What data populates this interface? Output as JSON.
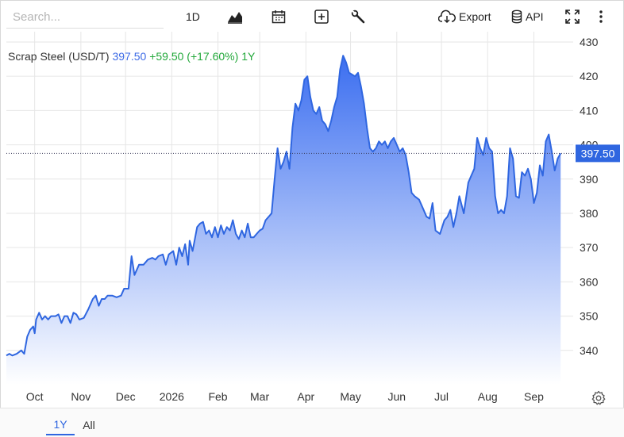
{
  "toolbar": {
    "search_placeholder": "Search...",
    "interval_label": "1D",
    "chart_type_icon": "area-chart-icon",
    "calendar_icon": "calendar-icon",
    "add_icon": "plus-box-icon",
    "tools_icon": "wrench-icon",
    "export_label": "Export",
    "export_icon": "cloud-download-icon",
    "api_label": "API",
    "api_icon": "database-icon",
    "fullscreen_icon": "fullscreen-icon",
    "menu_icon": "kebab-menu-icon"
  },
  "legend": {
    "name": "Scrap Steel (USD/T)",
    "price": "397.50",
    "change": "+59.50 (+17.60%)",
    "period": "1Y"
  },
  "price_tag": "397.50",
  "ranges": [
    {
      "label": "1Y",
      "active": true
    },
    {
      "label": "All",
      "active": false
    }
  ],
  "settings_icon": "gear-icon",
  "colors": {
    "line": "#2f66e0",
    "fill_top": "#3b6ef0",
    "fill_bottom": "#ffffff",
    "price_tag_bg": "#2f66e0",
    "positive": "#22a83a",
    "grid": "#e6e6e6"
  },
  "chart_data": {
    "type": "area",
    "title": "Scrap Steel (USD/T)",
    "xlabel": "",
    "ylabel": "",
    "ylim": [
      330,
      433
    ],
    "y_ticks": [
      340,
      350,
      360,
      370,
      380,
      390,
      400,
      410,
      420,
      430
    ],
    "x_ticks": [
      "Oct",
      "Nov",
      "Dec",
      "2026",
      "Feb",
      "Mar",
      "Apr",
      "May",
      "Jun",
      "Jul",
      "Aug",
      "Sep"
    ],
    "x_range": [
      "2025-09-12",
      "2026-09-21"
    ],
    "current_value": 397.5,
    "grid": true,
    "series": [
      {
        "name": "Scrap Steel (USD/T)",
        "points": [
          [
            "2025-09-12",
            338.5
          ],
          [
            "2025-09-14",
            339
          ],
          [
            "2025-09-16",
            338.5
          ],
          [
            "2025-09-19",
            339
          ],
          [
            "2025-09-22",
            340
          ],
          [
            "2025-09-24",
            339
          ],
          [
            "2025-09-26",
            344
          ],
          [
            "2025-09-28",
            346
          ],
          [
            "2025-09-30",
            347
          ],
          [
            "2025-10-01",
            345
          ],
          [
            "2025-10-02",
            349
          ],
          [
            "2025-10-04",
            351
          ],
          [
            "2025-10-06",
            349
          ],
          [
            "2025-10-08",
            350
          ],
          [
            "2025-10-10",
            349
          ],
          [
            "2025-10-12",
            350
          ],
          [
            "2025-10-15",
            350
          ],
          [
            "2025-10-17",
            350.5
          ],
          [
            "2025-10-19",
            348
          ],
          [
            "2025-10-21",
            350
          ],
          [
            "2025-10-23",
            350
          ],
          [
            "2025-10-25",
            348
          ],
          [
            "2025-10-27",
            351
          ],
          [
            "2025-10-29",
            350.5
          ],
          [
            "2025-10-31",
            349
          ],
          [
            "2025-11-03",
            349.5
          ],
          [
            "2025-11-06",
            352
          ],
          [
            "2025-11-09",
            355
          ],
          [
            "2025-11-11",
            356
          ],
          [
            "2025-11-13",
            353
          ],
          [
            "2025-11-15",
            355
          ],
          [
            "2025-11-17",
            355
          ],
          [
            "2025-11-19",
            356
          ],
          [
            "2025-11-22",
            356
          ],
          [
            "2025-11-25",
            355.5
          ],
          [
            "2025-11-28",
            356
          ],
          [
            "2025-11-30",
            358
          ],
          [
            "2025-12-03",
            358
          ],
          [
            "2025-12-05",
            367.5
          ],
          [
            "2025-12-07",
            362
          ],
          [
            "2025-12-10",
            365
          ],
          [
            "2025-12-13",
            365
          ],
          [
            "2025-12-16",
            366.5
          ],
          [
            "2025-12-19",
            367
          ],
          [
            "2025-12-21",
            366.5
          ],
          [
            "2025-12-23",
            367.5
          ],
          [
            "2025-12-26",
            368
          ],
          [
            "2025-12-28",
            365
          ],
          [
            "2025-12-30",
            368
          ],
          [
            "2026-01-02",
            369
          ],
          [
            "2026-01-04",
            365
          ],
          [
            "2026-01-06",
            370
          ],
          [
            "2026-01-08",
            367.5
          ],
          [
            "2026-01-10",
            371
          ],
          [
            "2026-01-12",
            365
          ],
          [
            "2026-01-13",
            372
          ],
          [
            "2026-01-15",
            369
          ],
          [
            "2026-01-18",
            376
          ],
          [
            "2026-01-20",
            377
          ],
          [
            "2026-01-22",
            377.5
          ],
          [
            "2026-01-24",
            374
          ],
          [
            "2026-01-26",
            375
          ],
          [
            "2026-01-28",
            373
          ],
          [
            "2026-01-30",
            376
          ],
          [
            "2026-02-01",
            373
          ],
          [
            "2026-02-03",
            376.5
          ],
          [
            "2026-02-05",
            374
          ],
          [
            "2026-02-07",
            376
          ],
          [
            "2026-02-09",
            375
          ],
          [
            "2026-02-11",
            378
          ],
          [
            "2026-02-13",
            374
          ],
          [
            "2026-02-15",
            372.5
          ],
          [
            "2026-02-17",
            375
          ],
          [
            "2026-02-19",
            373
          ],
          [
            "2026-02-21",
            377
          ],
          [
            "2026-02-23",
            373
          ],
          [
            "2026-02-25",
            373
          ],
          [
            "2026-02-27",
            374
          ],
          [
            "2026-03-01",
            375
          ],
          [
            "2026-03-03",
            375.5
          ],
          [
            "2026-03-05",
            378
          ],
          [
            "2026-03-07",
            379
          ],
          [
            "2026-03-09",
            380
          ],
          [
            "2026-03-11",
            390
          ],
          [
            "2026-03-13",
            399
          ],
          [
            "2026-03-15",
            393
          ],
          [
            "2026-03-17",
            395
          ],
          [
            "2026-03-19",
            398
          ],
          [
            "2026-03-21",
            393
          ],
          [
            "2026-03-23",
            405
          ],
          [
            "2026-03-25",
            412
          ],
          [
            "2026-03-27",
            410
          ],
          [
            "2026-03-29",
            413
          ],
          [
            "2026-03-31",
            419
          ],
          [
            "2026-04-02",
            420
          ],
          [
            "2026-04-04",
            414
          ],
          [
            "2026-04-06",
            410
          ],
          [
            "2026-04-08",
            409
          ],
          [
            "2026-04-10",
            411
          ],
          [
            "2026-04-12",
            407
          ],
          [
            "2026-04-14",
            406
          ],
          [
            "2026-04-16",
            404
          ],
          [
            "2026-04-18",
            407
          ],
          [
            "2026-04-20",
            411
          ],
          [
            "2026-04-22",
            414
          ],
          [
            "2026-04-24",
            422
          ],
          [
            "2026-04-26",
            426
          ],
          [
            "2026-04-28",
            424
          ],
          [
            "2026-04-30",
            421
          ],
          [
            "2026-05-02",
            420.5
          ],
          [
            "2026-05-04",
            420
          ],
          [
            "2026-05-06",
            421
          ],
          [
            "2026-05-08",
            417
          ],
          [
            "2026-05-10",
            412
          ],
          [
            "2026-05-12",
            405
          ],
          [
            "2026-05-14",
            399
          ],
          [
            "2026-05-16",
            398
          ],
          [
            "2026-05-18",
            399
          ],
          [
            "2026-05-20",
            401
          ],
          [
            "2026-05-22",
            400
          ],
          [
            "2026-05-24",
            401
          ],
          [
            "2026-05-26",
            399
          ],
          [
            "2026-05-28",
            401
          ],
          [
            "2026-05-30",
            402
          ],
          [
            "2026-06-01",
            400
          ],
          [
            "2026-06-03",
            398
          ],
          [
            "2026-06-05",
            399
          ],
          [
            "2026-06-07",
            397
          ],
          [
            "2026-06-09",
            392
          ],
          [
            "2026-06-11",
            386
          ],
          [
            "2026-06-13",
            385
          ],
          [
            "2026-06-16",
            384
          ],
          [
            "2026-06-19",
            381
          ],
          [
            "2026-06-21",
            379
          ],
          [
            "2026-06-23",
            378.5
          ],
          [
            "2026-06-25",
            383
          ],
          [
            "2026-06-27",
            375
          ],
          [
            "2026-06-30",
            374
          ],
          [
            "2026-07-03",
            378
          ],
          [
            "2026-07-05",
            379
          ],
          [
            "2026-07-07",
            381
          ],
          [
            "2026-07-09",
            376
          ],
          [
            "2026-07-11",
            380
          ],
          [
            "2026-07-13",
            385
          ],
          [
            "2026-07-16",
            380
          ],
          [
            "2026-07-19",
            389
          ],
          [
            "2026-07-21",
            391
          ],
          [
            "2026-07-23",
            393
          ],
          [
            "2026-07-25",
            402
          ],
          [
            "2026-07-27",
            399
          ],
          [
            "2026-07-29",
            397
          ],
          [
            "2026-07-31",
            402
          ],
          [
            "2026-08-02",
            399
          ],
          [
            "2026-08-04",
            398
          ],
          [
            "2026-08-06",
            385
          ],
          [
            "2026-08-08",
            380
          ],
          [
            "2026-08-10",
            381
          ],
          [
            "2026-08-12",
            380
          ],
          [
            "2026-08-14",
            385
          ],
          [
            "2026-08-16",
            399
          ],
          [
            "2026-08-18",
            396
          ],
          [
            "2026-08-20",
            385
          ],
          [
            "2026-08-22",
            384.5
          ],
          [
            "2026-08-24",
            392
          ],
          [
            "2026-08-26",
            391
          ],
          [
            "2026-08-28",
            393
          ],
          [
            "2026-08-30",
            390
          ],
          [
            "2026-09-01",
            383
          ],
          [
            "2026-09-03",
            386
          ],
          [
            "2026-09-05",
            394
          ],
          [
            "2026-09-07",
            391
          ],
          [
            "2026-09-09",
            401
          ],
          [
            "2026-09-11",
            403
          ],
          [
            "2026-09-13",
            398
          ],
          [
            "2026-09-15",
            392.5
          ],
          [
            "2026-09-17",
            396
          ],
          [
            "2026-09-19",
            397.5
          ]
        ]
      }
    ]
  }
}
